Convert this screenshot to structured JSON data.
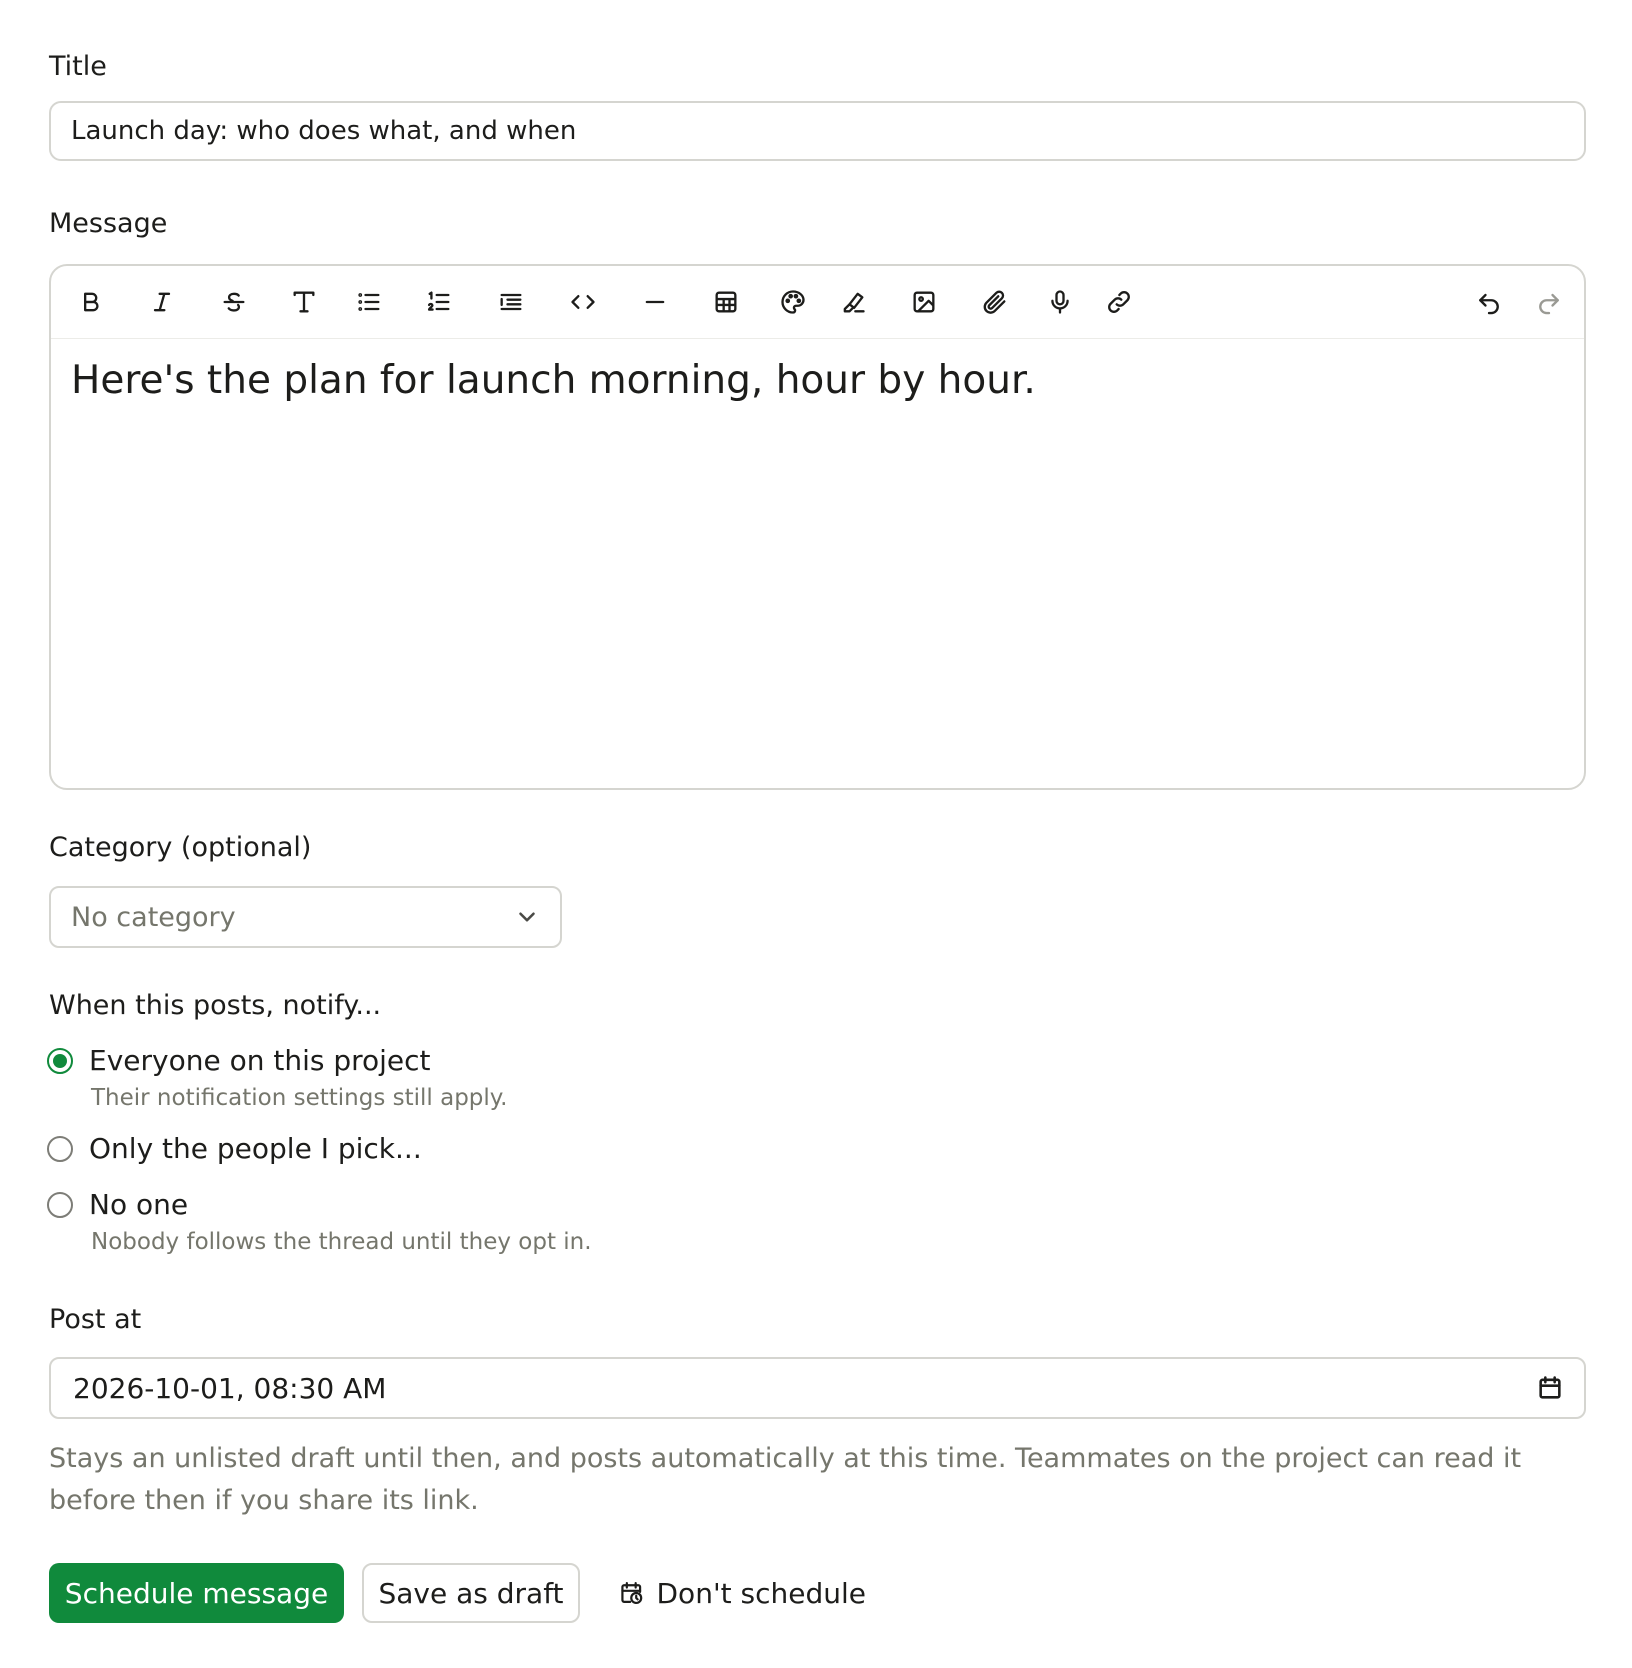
{
  "title_field": {
    "label": "Title",
    "value": "Launch day: who does what, and when"
  },
  "message_field": {
    "label": "Message",
    "body": "Here's the plan for launch morning, hour by hour.",
    "toolbar": [
      {
        "name": "bold",
        "icon": "bold-icon"
      },
      {
        "name": "italic",
        "icon": "italic-icon"
      },
      {
        "name": "strikethrough",
        "icon": "strikethrough-icon"
      },
      {
        "name": "heading",
        "icon": "heading-icon"
      },
      {
        "name": "bullet-list",
        "icon": "bullet-list-icon"
      },
      {
        "name": "numbered-list",
        "icon": "numbered-list-icon"
      },
      {
        "name": "indent",
        "icon": "indent-icon"
      },
      {
        "name": "code",
        "icon": "code-icon"
      },
      {
        "name": "horizontal-rule",
        "icon": "horizontal-rule-icon"
      },
      {
        "name": "table",
        "icon": "table-icon"
      },
      {
        "name": "color",
        "icon": "palette-icon"
      },
      {
        "name": "highlight",
        "icon": "highlighter-icon"
      },
      {
        "name": "image",
        "icon": "image-icon"
      },
      {
        "name": "attachment",
        "icon": "paperclip-icon"
      },
      {
        "name": "voice",
        "icon": "microphone-icon"
      },
      {
        "name": "link",
        "icon": "link-icon"
      },
      {
        "name": "undo",
        "icon": "undo-icon"
      },
      {
        "name": "redo",
        "icon": "redo-icon"
      }
    ]
  },
  "category_field": {
    "label": "Category (optional)",
    "selected": "No category"
  },
  "notify": {
    "label": "When this posts, notify...",
    "options": [
      {
        "label": "Everyone on this project",
        "hint": "Their notification settings still apply.",
        "checked": true
      },
      {
        "label": "Only the people I pick...",
        "hint": "",
        "checked": false
      },
      {
        "label": "No one",
        "hint": "Nobody follows the thread until they opt in.",
        "checked": false
      }
    ]
  },
  "post_at": {
    "label": "Post at",
    "value": "2026-10-01, 08:30  AM",
    "help": "Stays an unlisted draft until then, and posts automatically at this time. Teammates on the project can read it before then if you share its link."
  },
  "actions": {
    "schedule": "Schedule message",
    "save_draft": "Save as draft",
    "dont_schedule": "Don't schedule"
  },
  "colors": {
    "accent": "#108a3c",
    "border": "#d5d5d0",
    "muted_text": "#75766c",
    "text": "#1d1d1b"
  }
}
